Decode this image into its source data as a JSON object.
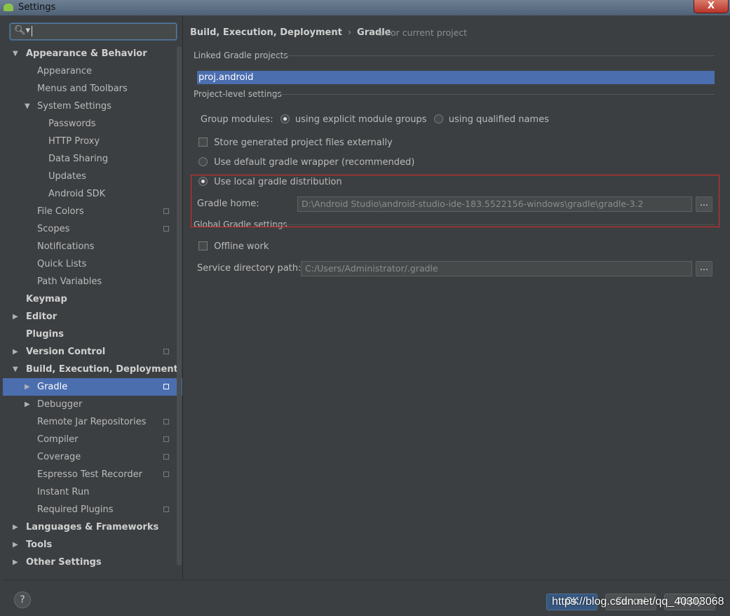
{
  "window": {
    "title": "Settings",
    "close_label": "X"
  },
  "search": {
    "value": ""
  },
  "tree": [
    {
      "label": "Appearance & Behavior",
      "level": 0,
      "bold": true,
      "arrow": "down",
      "pin": false
    },
    {
      "label": "Appearance",
      "level": 1,
      "bold": false,
      "arrow": "",
      "pin": false
    },
    {
      "label": "Menus and Toolbars",
      "level": 1,
      "bold": false,
      "arrow": "",
      "pin": false
    },
    {
      "label": "System Settings",
      "level": 1,
      "bold": false,
      "arrow": "down",
      "pin": false
    },
    {
      "label": "Passwords",
      "level": 2,
      "bold": false,
      "arrow": "",
      "pin": false
    },
    {
      "label": "HTTP Proxy",
      "level": 2,
      "bold": false,
      "arrow": "",
      "pin": false
    },
    {
      "label": "Data Sharing",
      "level": 2,
      "bold": false,
      "arrow": "",
      "pin": false
    },
    {
      "label": "Updates",
      "level": 2,
      "bold": false,
      "arrow": "",
      "pin": false
    },
    {
      "label": "Android SDK",
      "level": 2,
      "bold": false,
      "arrow": "",
      "pin": false
    },
    {
      "label": "File Colors",
      "level": 1,
      "bold": false,
      "arrow": "",
      "pin": true
    },
    {
      "label": "Scopes",
      "level": 1,
      "bold": false,
      "arrow": "",
      "pin": true
    },
    {
      "label": "Notifications",
      "level": 1,
      "bold": false,
      "arrow": "",
      "pin": false
    },
    {
      "label": "Quick Lists",
      "level": 1,
      "bold": false,
      "arrow": "",
      "pin": false
    },
    {
      "label": "Path Variables",
      "level": 1,
      "bold": false,
      "arrow": "",
      "pin": false
    },
    {
      "label": "Keymap",
      "level": 0,
      "bold": true,
      "arrow": "",
      "pin": false
    },
    {
      "label": "Editor",
      "level": 0,
      "bold": true,
      "arrow": "right",
      "pin": false
    },
    {
      "label": "Plugins",
      "level": 0,
      "bold": true,
      "arrow": "",
      "pin": false
    },
    {
      "label": "Version Control",
      "level": 0,
      "bold": true,
      "arrow": "right",
      "pin": true
    },
    {
      "label": "Build, Execution, Deployment",
      "level": 0,
      "bold": true,
      "arrow": "down",
      "pin": false
    },
    {
      "label": "Gradle",
      "level": 1,
      "bold": false,
      "arrow": "right",
      "pin": true,
      "selected": true
    },
    {
      "label": "Debugger",
      "level": 1,
      "bold": false,
      "arrow": "right",
      "pin": false
    },
    {
      "label": "Remote Jar Repositories",
      "level": 1,
      "bold": false,
      "arrow": "",
      "pin": true
    },
    {
      "label": "Compiler",
      "level": 1,
      "bold": false,
      "arrow": "",
      "pin": true
    },
    {
      "label": "Coverage",
      "level": 1,
      "bold": false,
      "arrow": "",
      "pin": true
    },
    {
      "label": "Espresso Test Recorder",
      "level": 1,
      "bold": false,
      "arrow": "",
      "pin": true
    },
    {
      "label": "Instant Run",
      "level": 1,
      "bold": false,
      "arrow": "",
      "pin": false
    },
    {
      "label": "Required Plugins",
      "level": 1,
      "bold": false,
      "arrow": "",
      "pin": true
    },
    {
      "label": "Languages & Frameworks",
      "level": 0,
      "bold": true,
      "arrow": "right",
      "pin": false
    },
    {
      "label": "Tools",
      "level": 0,
      "bold": true,
      "arrow": "right",
      "pin": false
    },
    {
      "label": "Other Settings",
      "level": 0,
      "bold": true,
      "arrow": "right",
      "pin": false
    }
  ],
  "breadcrumb": {
    "parent": "Build, Execution, Deployment",
    "sep": "›",
    "current": "Gradle",
    "scope": "For current project"
  },
  "linked": {
    "title": "Linked Gradle projects",
    "project": "proj.android"
  },
  "project_settings": {
    "title": "Project-level settings",
    "group_modules_label": "Group modules:",
    "radio_explicit": "using explicit module groups",
    "radio_qualified": "using qualified names",
    "store_external": "Store generated project files externally",
    "default_wrapper": "Use default gradle wrapper (recommended)",
    "local_distribution": "Use local gradle distribution",
    "gradle_home_label": "Gradle home:",
    "gradle_home_value": "D:\\Android Studio\\android-studio-ide-183.5522156-windows\\gradle\\gradle-3.2",
    "browse_label": "..."
  },
  "global_settings": {
    "title": "Global Gradle settings",
    "offline_work": "Offline work",
    "service_dir_label": "Service directory path:",
    "service_dir_value": "C:/Users/Administrator/.gradle",
    "browse_label": "..."
  },
  "footer": {
    "help": "?",
    "ok": "OK",
    "cancel": "Cancel",
    "apply": "Apply"
  },
  "watermark": "https://blog.csdn.net/qq_40303068"
}
